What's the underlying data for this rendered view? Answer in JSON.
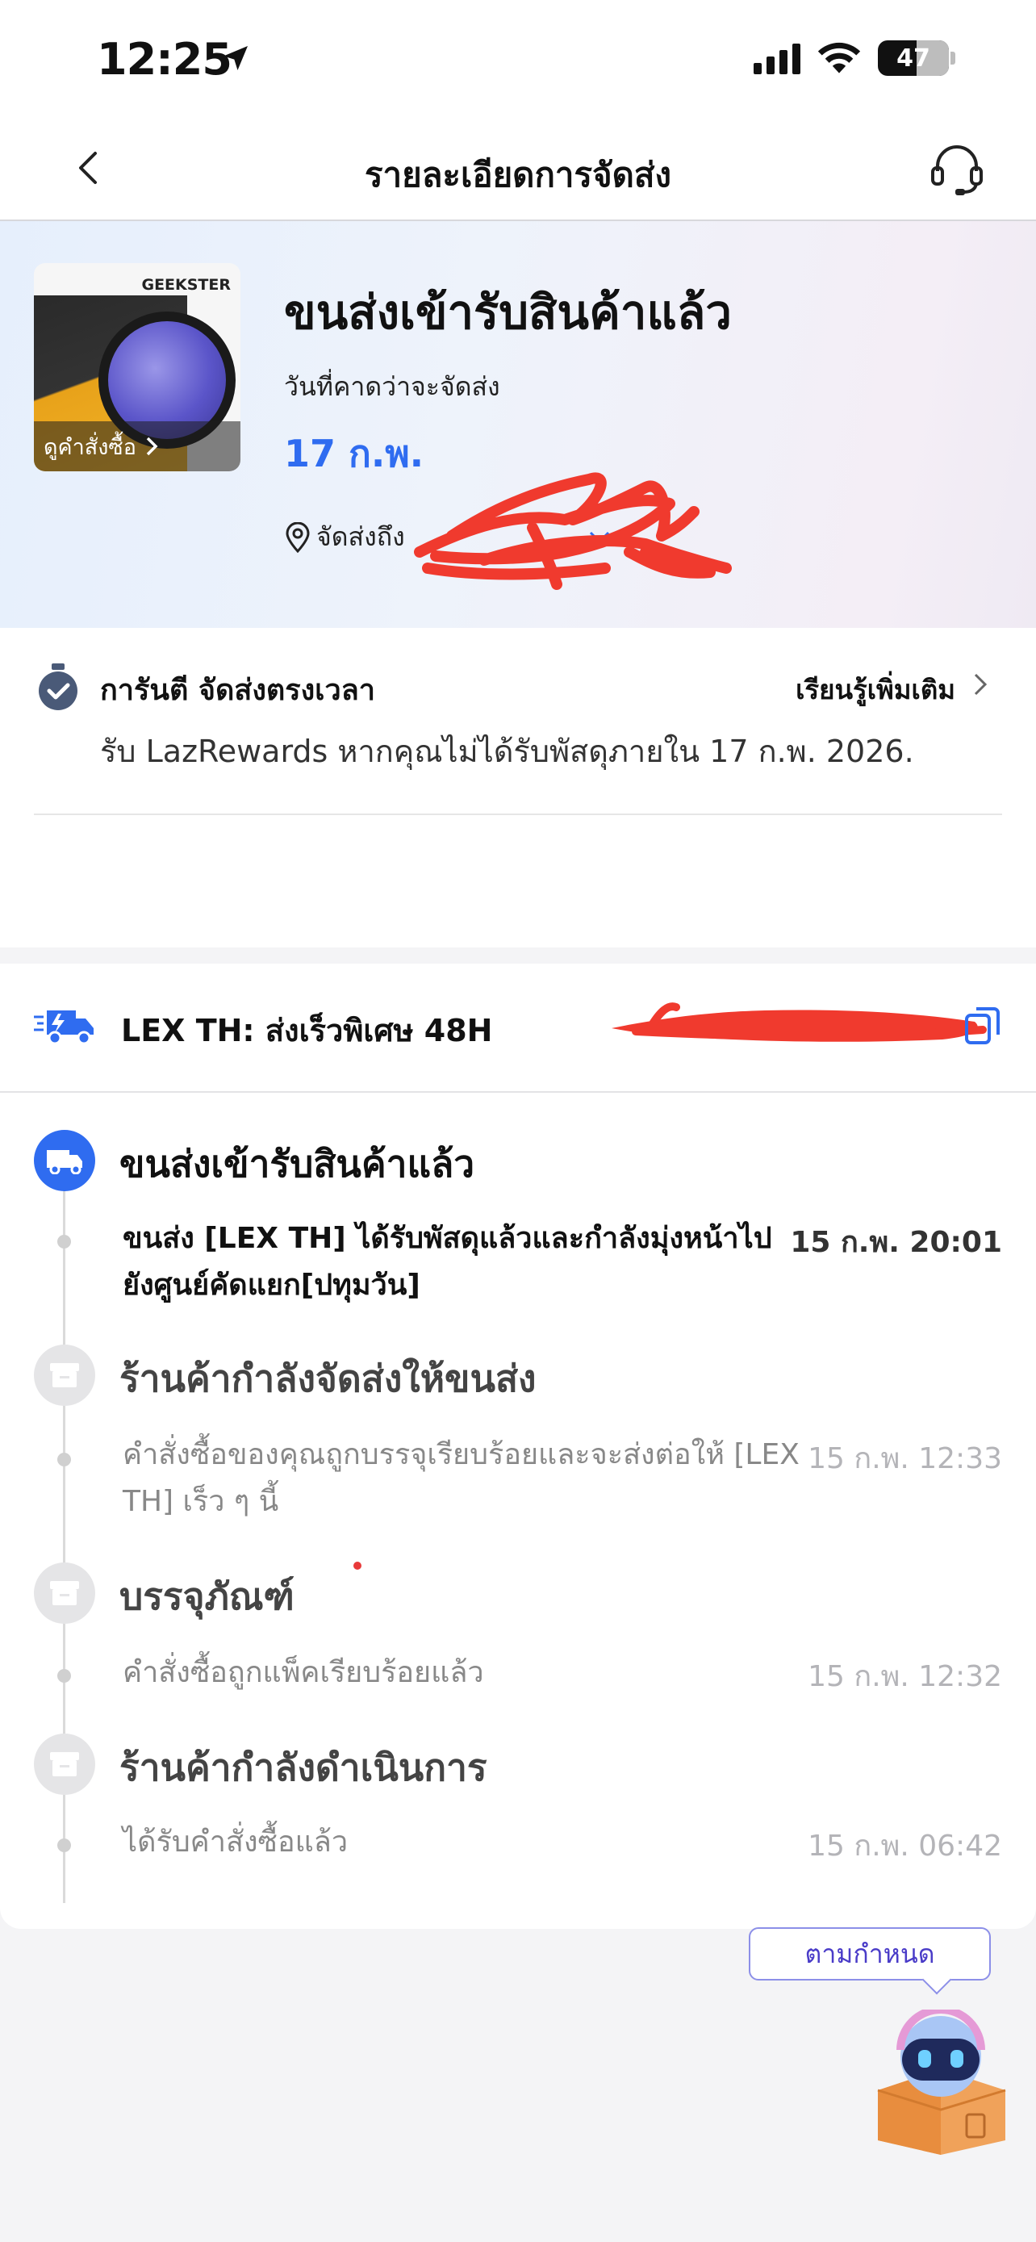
{
  "status_bar": {
    "time": "12:25",
    "battery": "47"
  },
  "nav": {
    "title": "รายละเอียดการจัดส่ง"
  },
  "hero": {
    "product": {
      "brand": "GEEKSTER",
      "view_order_label": "ดูคำสั่งซื้อ"
    },
    "status": "ขนส่งเข้ารับสินค้าแล้ว",
    "eta_label": "วันที่คาดว่าจะจัดส่ง",
    "eta_date": "17 ก.พ.",
    "address_label": "จัดส่งถึง"
  },
  "guarantee": {
    "title": "การันตี จัดส่งตรงเวลา",
    "learn_more": "เรียนรู้เพิ่มเติม",
    "description": "รับ LazRewards หากคุณไม่ได้รับพัสดุภายใน 17 ก.พ. 2026."
  },
  "carrier": {
    "name": "LEX TH: ส่งเร็วพิเศษ 48H"
  },
  "timeline": [
    {
      "heading": "ขนส่งเข้ารับสินค้าแล้ว",
      "description": "ขนส่ง [LEX TH] ได้รับพัสดุแล้วและกำลังมุ่งหน้าไปยังศูนย์คัดแยก[ปทุมวัน]",
      "time": "15 ก.พ. 20:01",
      "active": true
    },
    {
      "heading": "ร้านค้ากำลังจัดส่งให้ขนส่ง",
      "description": "คำสั่งซื้อของคุณถูกบรรจุเรียบร้อยและจะส่งต่อให้ [LEX TH] เร็ว ๆ นี้",
      "time": "15 ก.พ. 12:33",
      "active": false
    },
    {
      "heading": "บรรจุภัณฑ์",
      "description": "คำสั่งซื้อถูกแพ็คเรียบร้อยแล้ว",
      "time": "15 ก.พ. 12:32",
      "active": false
    },
    {
      "heading": "ร้านค้ากำลังดำเนินการ",
      "description": "ได้รับคำสั่งซื้อแล้ว",
      "time": "15 ก.พ. 06:42",
      "active": false
    }
  ],
  "assistant": {
    "bubble_text": "ตามกำหนด"
  },
  "colors": {
    "accent_blue": "#2f6cf0",
    "redaction_red": "#f03a2e"
  }
}
